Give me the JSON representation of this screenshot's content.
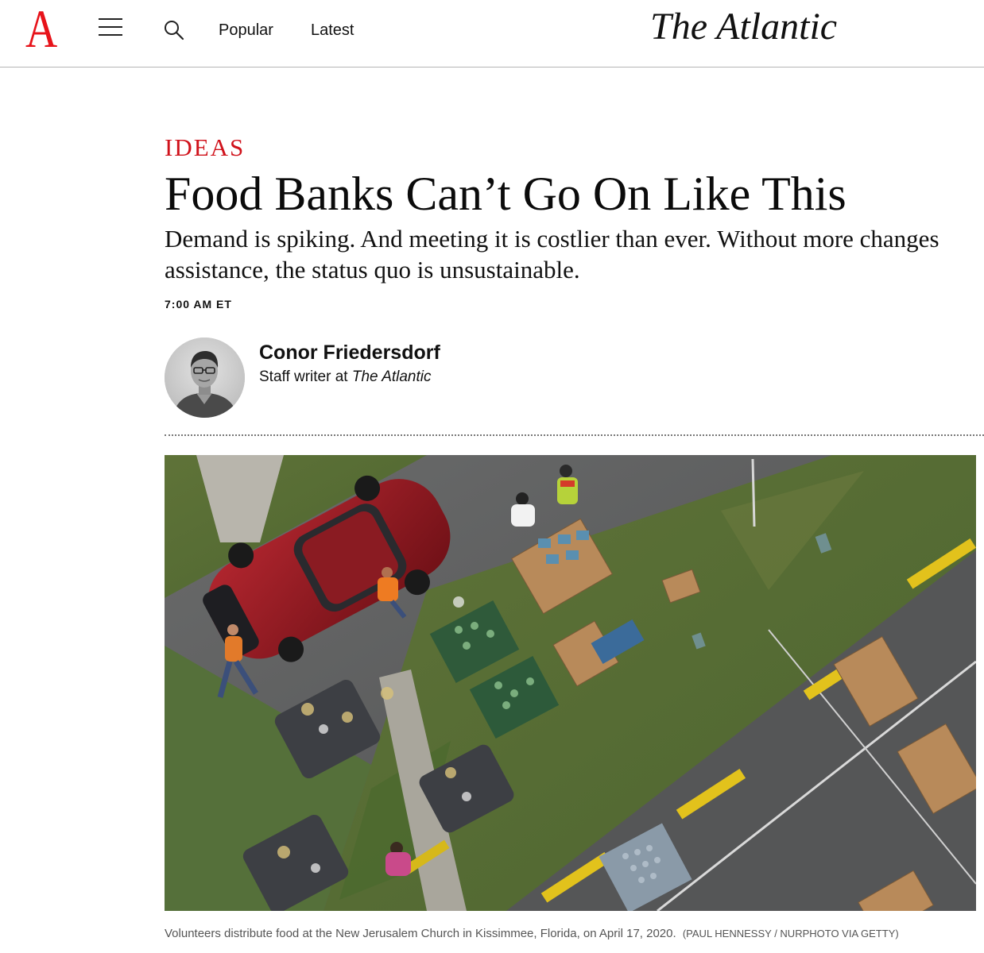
{
  "header": {
    "logo_letter": "A",
    "nav": {
      "popular": "Popular",
      "latest": "Latest"
    },
    "wordmark": "The Atlantic",
    "icons": [
      "menu-icon",
      "search-icon"
    ]
  },
  "article": {
    "rubric": "IDEAS",
    "headline": "Food Banks Can’t Go On Like This",
    "dek": "Demand is spiking. And meeting it is costlier than ever. Without more changes to assistance, the status quo is unsustainable.",
    "dek_visible": "Demand is spiking. And meeting it is costlier than ever. Without more changes assistance, the status quo is unsustainable.",
    "timestamp": "7:00 AM ET"
  },
  "author": {
    "name": "Conor Friedersdorf",
    "role_prefix": "Staff writer at",
    "role_publication": "The Atlantic"
  },
  "hero": {
    "caption": "Volunteers distribute food at the New Jerusalem Church in Kissimmee, Florida, on April 17, 2020.",
    "credit": "(PAUL HENNESSY / NURPHOTO VIA GETTY)"
  },
  "colors": {
    "brand_red": "#e7131a",
    "rubric_red": "#d0121b",
    "text": "#111111",
    "caption": "#555555"
  }
}
